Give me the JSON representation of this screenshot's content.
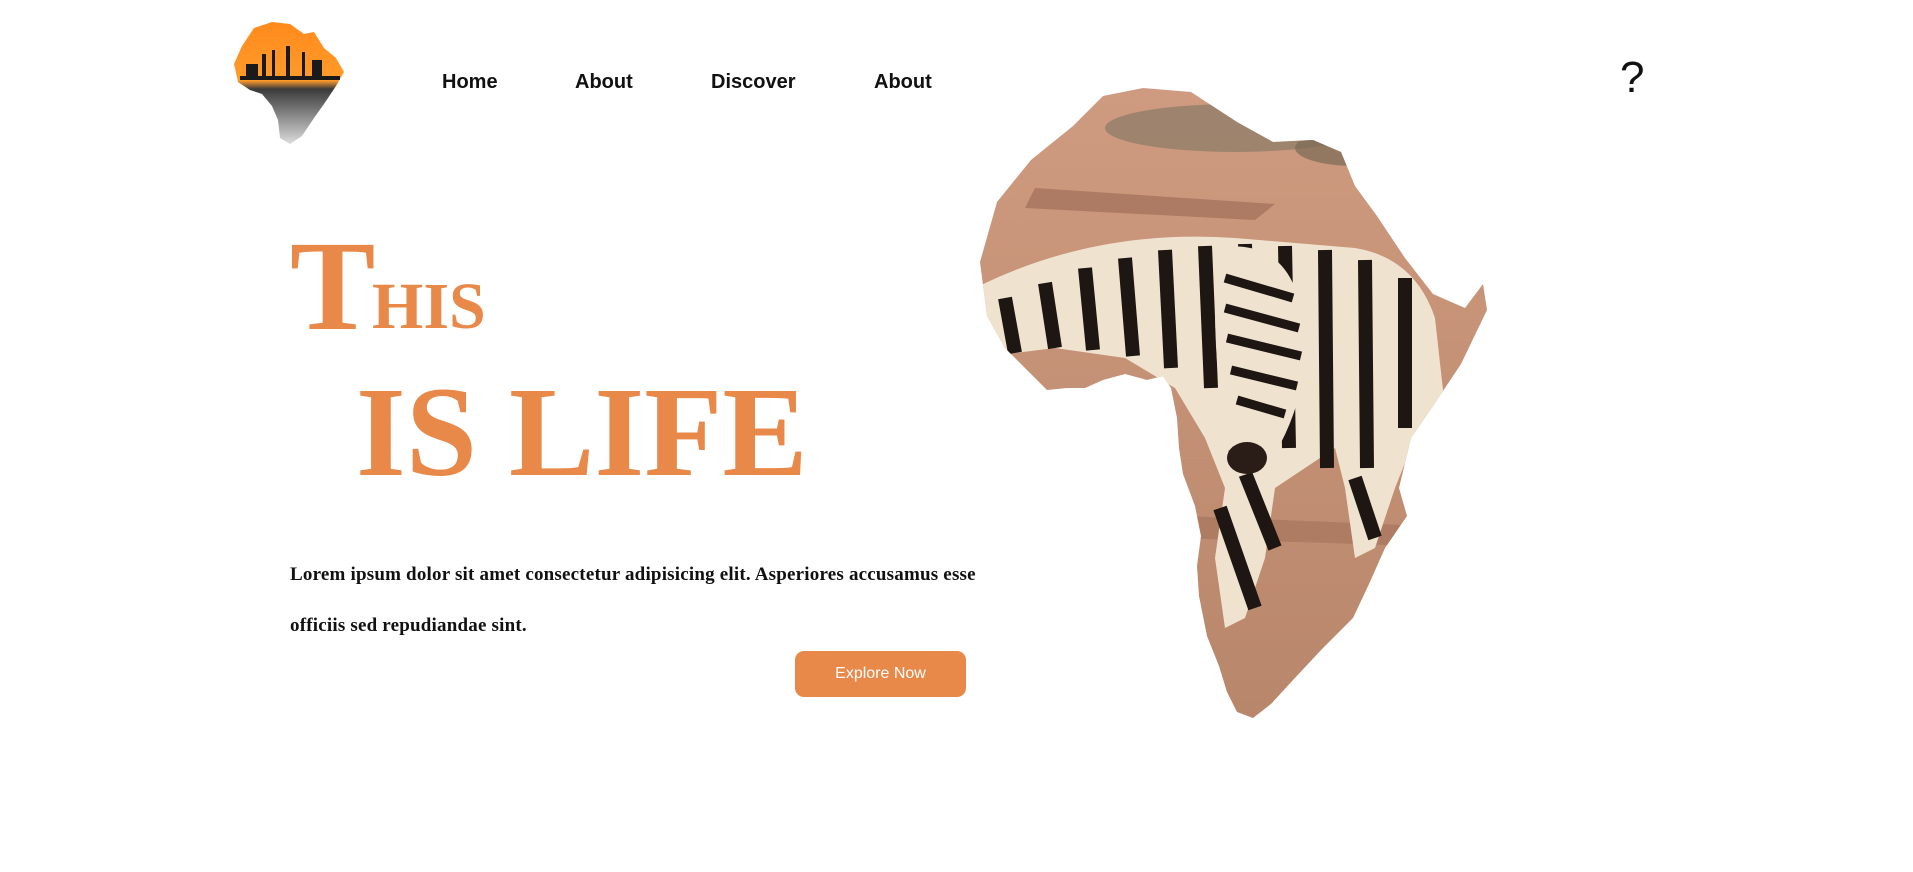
{
  "brand": {
    "logo_name": "africa-safari-logo"
  },
  "nav": {
    "items": [
      {
        "label": "Home"
      },
      {
        "label": "About"
      },
      {
        "label": "Discover"
      },
      {
        "label": "About"
      }
    ],
    "help_label": "?"
  },
  "hero": {
    "title_initial": "T",
    "title_rest": "HIS",
    "title_line2": "IS LIFE",
    "description": "Lorem ipsum dolor sit amet consectetur adipisicing elit. Asperiores accusamus esse officiis sed repudiandae sint.",
    "cta_label": "Explore Now"
  },
  "colors": {
    "accent": "#e8894a",
    "text": "#111111",
    "background": "#ffffff"
  },
  "image": {
    "name": "africa-map-zebra-image"
  }
}
